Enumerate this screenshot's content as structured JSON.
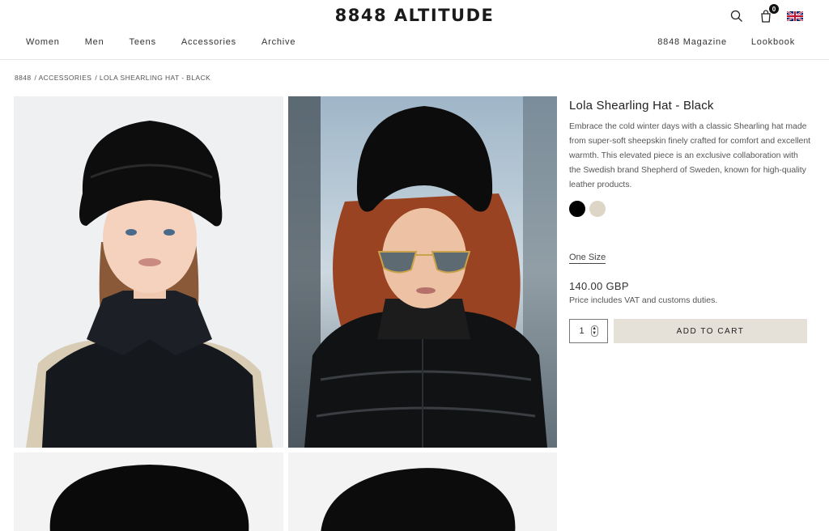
{
  "header": {
    "logo": "8848 ALTITUDE",
    "cart_count": "0",
    "nav_left": [
      "Women",
      "Men",
      "Teens",
      "Accessories",
      "Archive"
    ],
    "nav_right": [
      "8848 Magazine",
      "Lookbook"
    ],
    "icons": [
      "search-icon",
      "cart-icon",
      "uk-flag-icon"
    ]
  },
  "breadcrumb": [
    "8848",
    "/ ACCESSORIES",
    "/ LOLA SHEARLING HAT - BLACK"
  ],
  "gallery": {
    "images": [
      "model-black-hat-black-top",
      "model-black-hat-sunglasses-puffer-jacket",
      "black-hat-front",
      "black-hat-side"
    ]
  },
  "product": {
    "title": "Lola Shearling Hat - Black",
    "description": "Embrace the cold winter days with a classic Shearling hat made from super-soft sheepskin finely crafted for comfort and excellent warmth. This elevated piece is an exclusive collaboration with the Swedish brand Shepherd of Sweden, known for high-quality leather products.",
    "swatches": [
      "#000000",
      "#ddd5c5"
    ],
    "size": "One Size",
    "price": "140.00 GBP",
    "vat_note": "Price includes VAT and customs duties.",
    "quantity": "1",
    "add_to_cart": "ADD TO CART"
  }
}
